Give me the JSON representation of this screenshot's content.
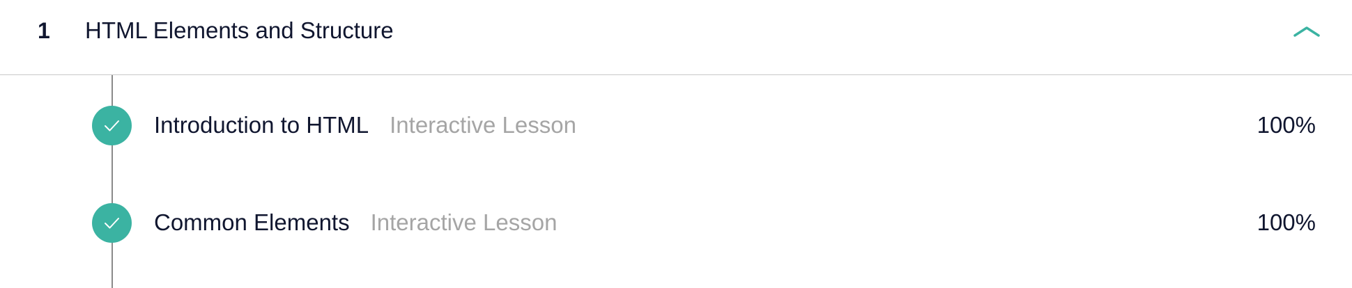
{
  "module": {
    "number": "1",
    "title": "HTML Elements and Structure",
    "toggle_icon": "chevron-up-icon",
    "accent_color": "#3bb3a2"
  },
  "lessons": [
    {
      "title": "Introduction to HTML",
      "type": "Interactive Lesson",
      "progress": "100%",
      "status": "complete",
      "status_icon": "check-icon"
    },
    {
      "title": "Common Elements",
      "type": "Interactive Lesson",
      "progress": "100%",
      "status": "complete",
      "status_icon": "check-icon"
    }
  ]
}
